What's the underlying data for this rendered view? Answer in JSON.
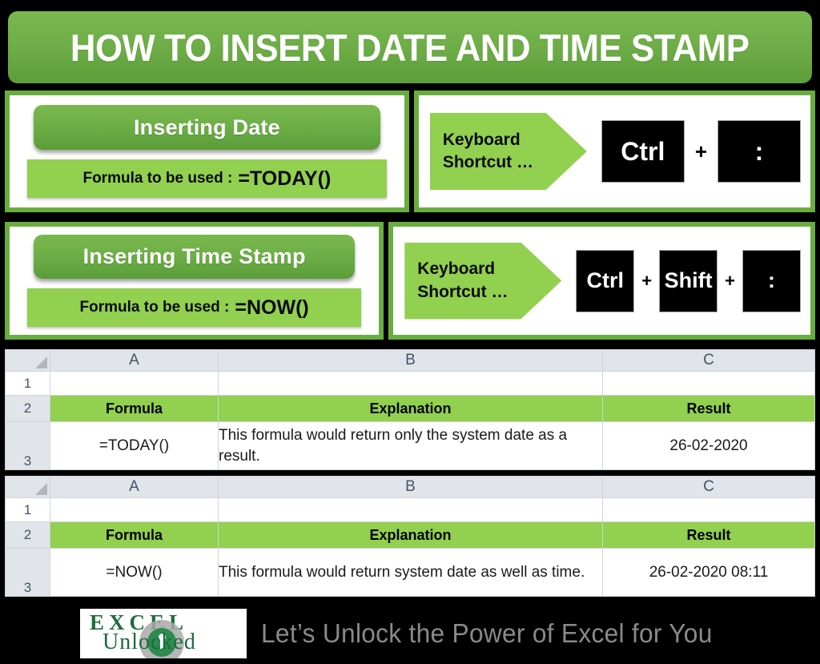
{
  "banner": {
    "title": "HOW TO INSERT DATE AND TIME STAMP"
  },
  "colors": {
    "banner_green": "#6fae48",
    "pill_green": "#6cae46",
    "light_green": "#92d050",
    "panel_border_green": "#6aad3f",
    "key_black": "#000000",
    "header_gray": "#e1e4e8",
    "logo_green": "#1d6b3f",
    "tagline_gray": "#8a8a8a"
  },
  "sections": [
    {
      "heading": "Inserting Date",
      "formula_label": "Formula to be used :",
      "formula_value": "=TODAY()",
      "shortcut_label_line1": "Keyboard",
      "shortcut_label_line2": "Shortcut …",
      "keys": [
        "Ctrl",
        ":"
      ],
      "key_separator": "+"
    },
    {
      "heading": "Inserting Time Stamp",
      "formula_label": "Formula to be used :",
      "formula_value": "=NOW()",
      "shortcut_label_line1": "Keyboard",
      "shortcut_label_line2": "Shortcut …",
      "keys": [
        "Ctrl",
        "Shift",
        ":"
      ],
      "key_separator": "+"
    }
  ],
  "sheets": [
    {
      "column_headers": [
        "A",
        "B",
        "C"
      ],
      "row_numbers": [
        "1",
        "2",
        "3"
      ],
      "table_headers": [
        "Formula",
        "Explanation",
        "Result"
      ],
      "data_row": {
        "formula": "=TODAY()",
        "explanation": "This formula would return only the system date as a result.",
        "result": "26-02-2020"
      }
    },
    {
      "column_headers": [
        "A",
        "B",
        "C"
      ],
      "row_numbers": [
        "1",
        "2",
        "3"
      ],
      "table_headers": [
        "Formula",
        "Explanation",
        "Result"
      ],
      "data_row": {
        "formula": "=NOW()",
        "explanation": "This formula would return system date as well as time.",
        "result": "26-02-2020 08:11"
      }
    }
  ],
  "footer": {
    "logo_line1": "EXCEL",
    "logo_line2": "Unlocked",
    "tagline": "Let’s Unlock the Power of Excel for You"
  }
}
